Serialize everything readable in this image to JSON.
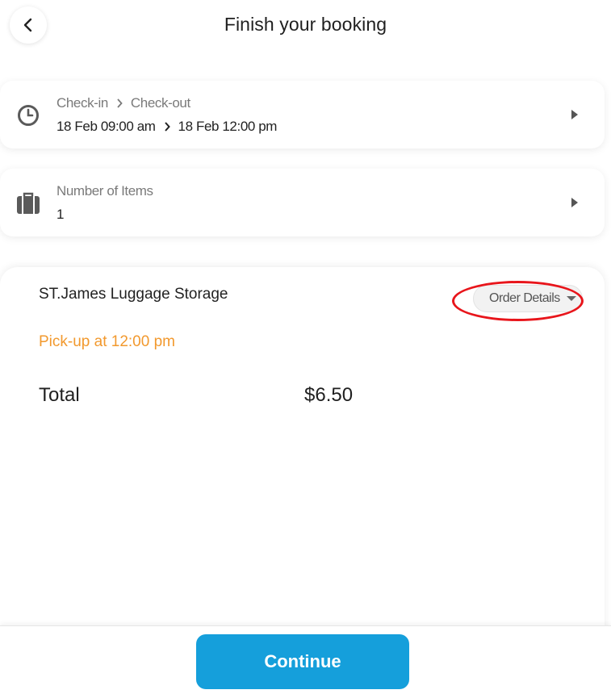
{
  "header": {
    "title": "Finish your booking",
    "back_icon": "chevron-left-icon"
  },
  "dates_card": {
    "icon": "clock-icon",
    "checkin_label": "Check-in",
    "checkout_label": "Check-out",
    "checkin_value": "18 Feb 09:00 am",
    "checkout_value": "18 Feb 12:00 pm"
  },
  "items_card": {
    "icon": "luggage-icon",
    "label": "Number of Items",
    "value": "1"
  },
  "summary": {
    "store_name": "ST.James Luggage Storage",
    "order_details_label": "Order Details",
    "pickup_text": "Pick-up at 12:00 pm",
    "total_label": "Total",
    "total_value": "$6.50",
    "pickup_color": "#f2992e"
  },
  "footer": {
    "continue_label": "Continue",
    "button_color": "#159fdb"
  },
  "annotation": {
    "ring_color": "#e8151b"
  }
}
